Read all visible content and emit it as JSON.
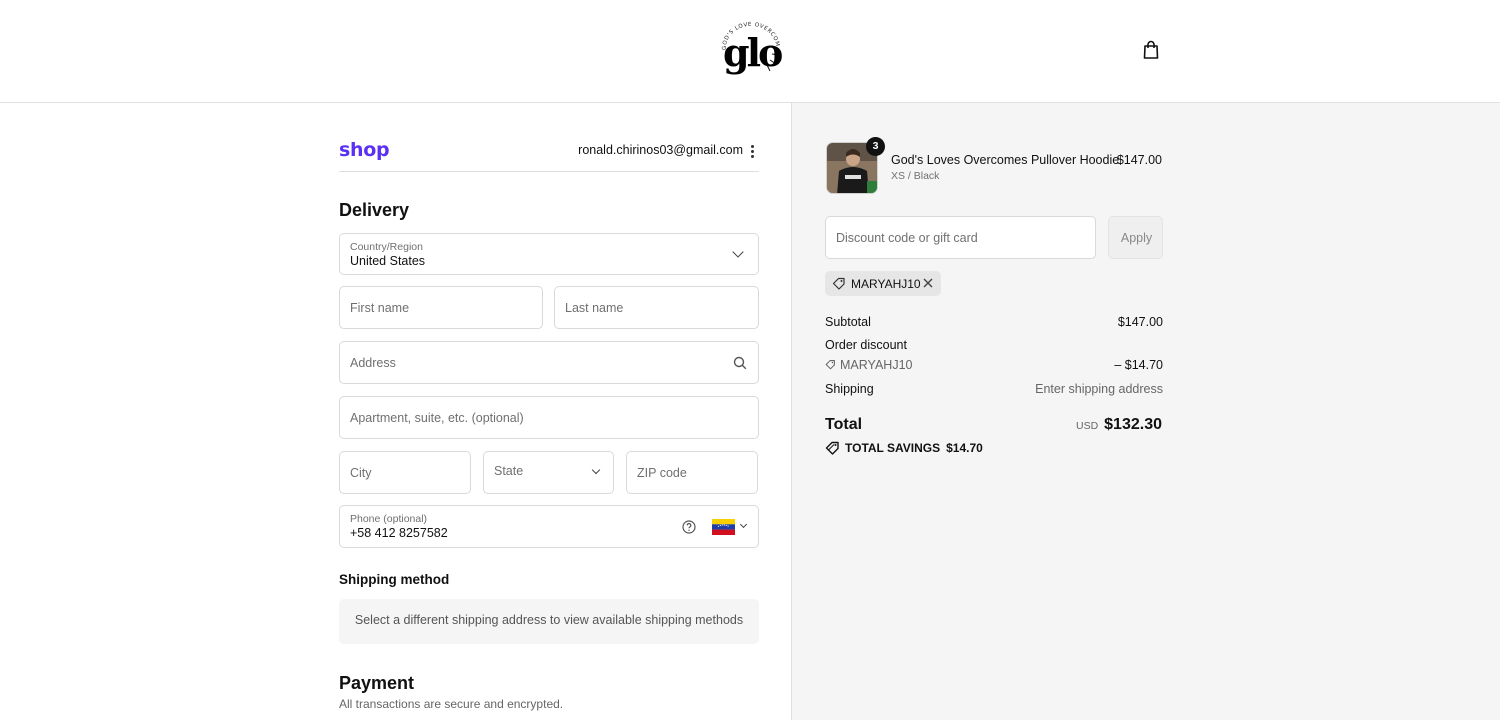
{
  "header": {
    "logo_word": "glo",
    "logo_ring_text": "GOD'S LOVE OVERCOMES",
    "cart_icon": "shopping-bag-icon"
  },
  "account": {
    "shop_label": "shop",
    "email": "ronald.chirinos03@gmail.com",
    "menu_icon": "more-vertical-icon"
  },
  "delivery": {
    "title": "Delivery",
    "country_label": "Country/Region",
    "country_value": "United States",
    "first_name_placeholder": "First name",
    "last_name_placeholder": "Last name",
    "address_placeholder": "Address",
    "apartment_placeholder": "Apartment, suite, etc. (optional)",
    "city_placeholder": "City",
    "state_placeholder": "State",
    "zip_placeholder": "ZIP code",
    "phone_label": "Phone (optional)",
    "phone_value": "+58 412 8257582",
    "phone_country_flag": "Venezuela"
  },
  "shipping": {
    "title": "Shipping method",
    "message": "Select a different shipping address to view available shipping methods"
  },
  "payment": {
    "title": "Payment",
    "subtitle": "All transactions are secure and encrypted."
  },
  "order": {
    "item": {
      "quantity": "3",
      "name": "God's Loves Overcomes Pullover Hoodie",
      "variant": "XS / Black",
      "price": "$147.00"
    },
    "discount_placeholder": "Discount code or gift card",
    "apply_label": "Apply",
    "applied_code": "MARYAHJ10",
    "subtotal_label": "Subtotal",
    "subtotal_value": "$147.00",
    "order_discount_label": "Order discount",
    "discount_code": "MARYAHJ10",
    "discount_value": "– $14.70",
    "shipping_label": "Shipping",
    "shipping_value": "Enter shipping address",
    "total_label": "Total",
    "currency": "USD",
    "total_value": "$132.30",
    "savings_label": "TOTAL SAVINGS",
    "savings_value": "$14.70"
  },
  "colors": {
    "shop_brand": "#5a31f4",
    "summary_bg": "#f5f5f5"
  }
}
